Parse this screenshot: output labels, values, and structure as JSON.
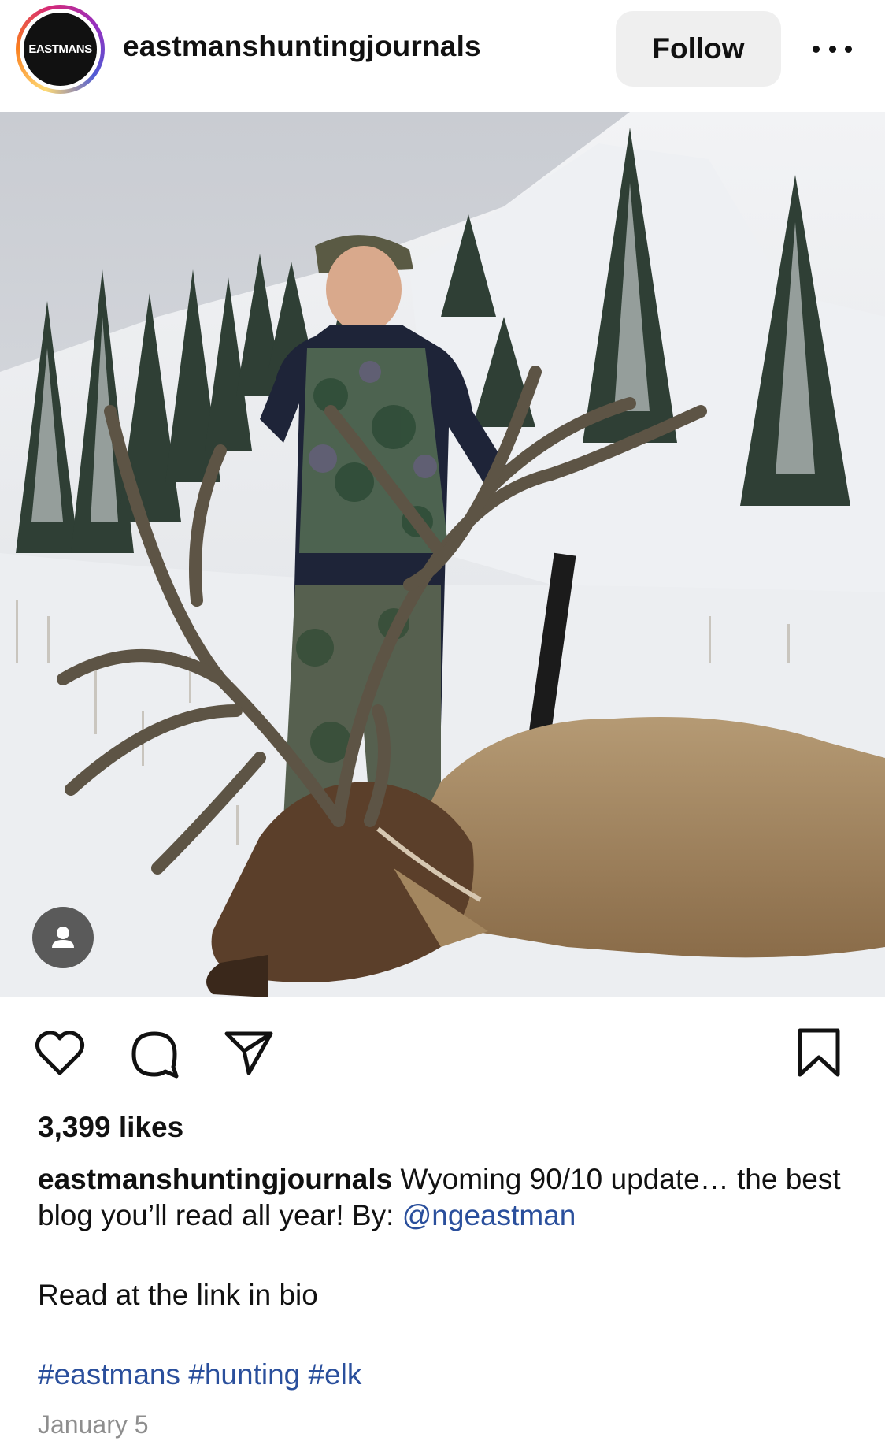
{
  "header": {
    "avatar_text": "EASTMANS",
    "username": "eastmanshuntingjournals",
    "follow_label": "Follow",
    "more_icon": "more-horizontal-icon"
  },
  "post": {
    "image_description_icon": "photo",
    "tag_icon": "user-tag-icon"
  },
  "actions": {
    "like_icon": "heart-icon",
    "comment_icon": "comment-icon",
    "share_icon": "share-icon",
    "save_icon": "bookmark-icon"
  },
  "likes_text": "3,399 likes",
  "caption": {
    "username": "eastmanshuntingjournals",
    "text": " Wyoming 90/10 update… the best blog you’ll read all year! By: ",
    "mention": "@ngeastman",
    "line2": "Read at the link in bio",
    "hashtags": "#eastmans #hunting #elk"
  },
  "date": "January 5",
  "colors": {
    "link": "#2a4f9c",
    "muted": "#8e8e8e",
    "button_bg": "#efefef"
  }
}
